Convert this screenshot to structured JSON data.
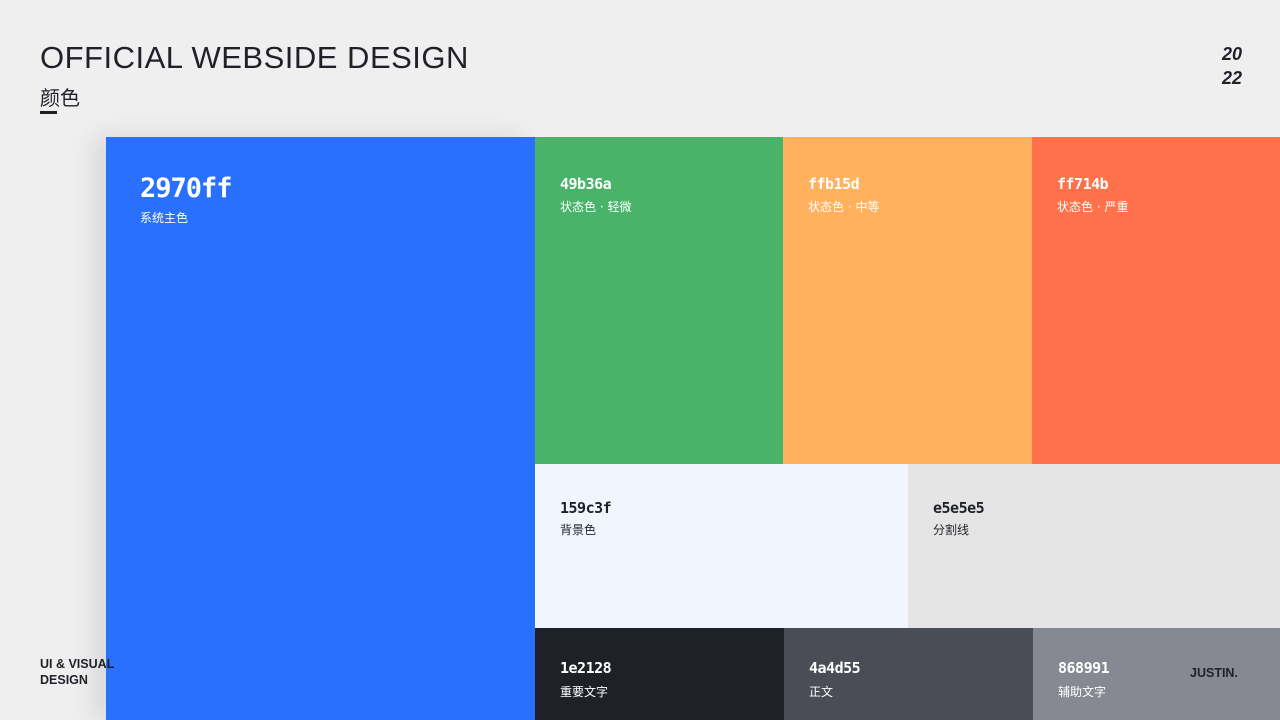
{
  "header": {
    "title": "OFFICIAL WEBSIDE DESIGN",
    "subtitle": "颜色",
    "year_line1": "20",
    "year_line2": "22"
  },
  "footer": {
    "left_line1": "UI & VISUAL",
    "left_line2": "DESIGN",
    "right": "JUSTIN."
  },
  "swatches": [
    {
      "hex": "2970ff",
      "label": "系统主色",
      "color": "#2970ff",
      "text_color": "#ffffff"
    },
    {
      "hex": "49b36a",
      "label": "状态色 · 轻微",
      "color": "#49b36a",
      "text_color": "#ffffff"
    },
    {
      "hex": "ffb15d",
      "label": "状态色 · 中等",
      "color": "#ffb15d",
      "text_color": "#ffffff"
    },
    {
      "hex": "ff714b",
      "label": "状态色 · 严重",
      "color": "#ff714b",
      "text_color": "#ffffff"
    },
    {
      "hex": "159c3f",
      "label": "背景色",
      "color": "#f1f5fe",
      "text_color": "#1e2128"
    },
    {
      "hex": "e5e5e5",
      "label": "分割线",
      "color": "#e5e5e5",
      "text_color": "#1e2128"
    },
    {
      "hex": "1e2128",
      "label": "重要文字",
      "color": "#1e2128",
      "text_color": "#ffffff"
    },
    {
      "hex": "4a4d55",
      "label": "正文",
      "color": "#4a4d55",
      "text_color": "#ffffff"
    },
    {
      "hex": "868991",
      "label": "辅助文字",
      "color": "#868991",
      "text_color": "#ffffff"
    }
  ]
}
